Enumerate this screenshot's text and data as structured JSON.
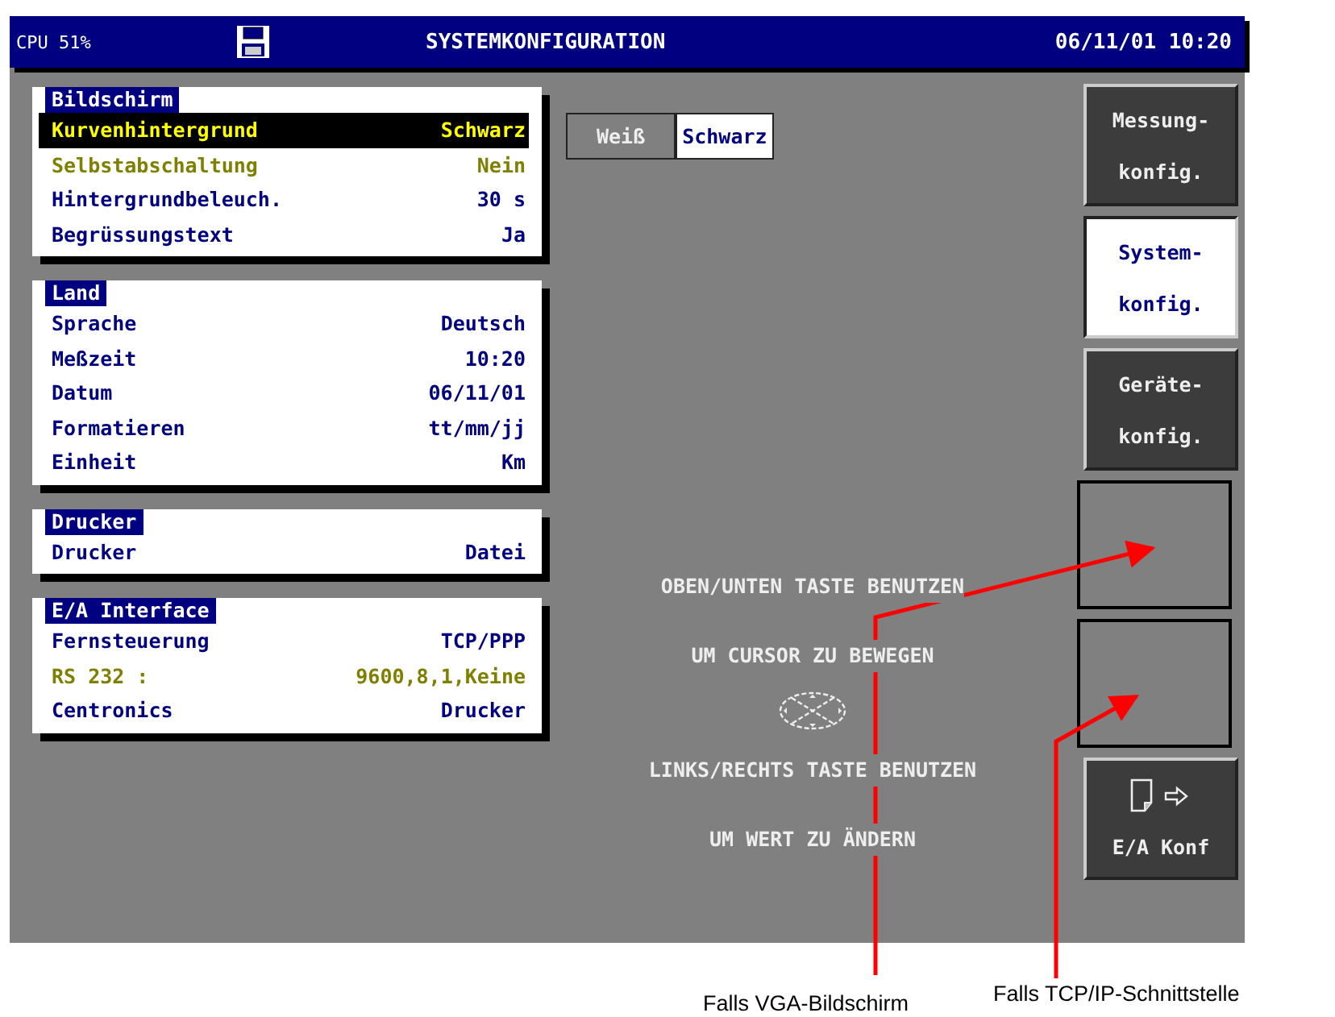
{
  "title_bar": {
    "cpu": "CPU 51%",
    "title": "SYSTEMKONFIGURATION",
    "datetime": "06/11/01 10:20"
  },
  "sections": [
    {
      "title": "Bildschirm",
      "rows": [
        {
          "label": "Kurvenhintergrund",
          "value": "Schwarz",
          "selected": true,
          "disabled": false
        },
        {
          "label": "Selbstabschaltung",
          "value": "Nein",
          "selected": false,
          "disabled": true
        },
        {
          "label": "Hintergrundbeleuch.",
          "value": "30 s",
          "selected": false,
          "disabled": false
        },
        {
          "label": "Begrüssungstext",
          "value": "Ja",
          "selected": false,
          "disabled": false
        }
      ]
    },
    {
      "title": "Land",
      "rows": [
        {
          "label": "Sprache",
          "value": "Deutsch",
          "selected": false,
          "disabled": false
        },
        {
          "label": "Meßzeit",
          "value": "10:20",
          "selected": false,
          "disabled": false
        },
        {
          "label": "Datum",
          "value": "06/11/01",
          "selected": false,
          "disabled": false
        },
        {
          "label": "Formatieren",
          "value": "tt/mm/jj",
          "selected": false,
          "disabled": false
        },
        {
          "label": "Einheit",
          "value": "Km",
          "selected": false,
          "disabled": false
        }
      ]
    },
    {
      "title": "Drucker",
      "rows": [
        {
          "label": "Drucker",
          "value": "Datei",
          "selected": false,
          "disabled": false
        }
      ]
    },
    {
      "title": "E/A Interface",
      "rows": [
        {
          "label": "Fernsteuerung",
          "value": "TCP/PPP",
          "selected": false,
          "disabled": false
        },
        {
          "label": "RS 232 :",
          "value": "9600,8,1,Keine",
          "selected": false,
          "disabled": true
        },
        {
          "label": "Centronics",
          "value": "Drucker",
          "selected": false,
          "disabled": false
        }
      ]
    }
  ],
  "options": [
    {
      "label": "Weiß",
      "selected": false
    },
    {
      "label": "Schwarz",
      "selected": true
    }
  ],
  "instructions": [
    "OBEN/UNTEN TASTE BENUTZEN",
    "UM CURSOR ZU BEWEGEN",
    "LINKS/RECHTS TASTE BENUTZEN",
    "UM WERT ZU ÄNDERN"
  ],
  "softkeys": [
    {
      "kind": "label",
      "lines": [
        "Messung-",
        "konfig."
      ],
      "selected": false
    },
    {
      "kind": "label",
      "lines": [
        "System-",
        "konfig."
      ],
      "selected": true
    },
    {
      "kind": "label",
      "lines": [
        "Geräte-",
        "konfig."
      ],
      "selected": false
    },
    {
      "kind": "empty"
    },
    {
      "kind": "empty"
    },
    {
      "kind": "icon",
      "lines": [
        "E/A Konf"
      ],
      "selected": false
    }
  ],
  "annotations": [
    "Falls VGA-Bildschirm",
    "Falls TCP/IP-Schnittstelle"
  ]
}
